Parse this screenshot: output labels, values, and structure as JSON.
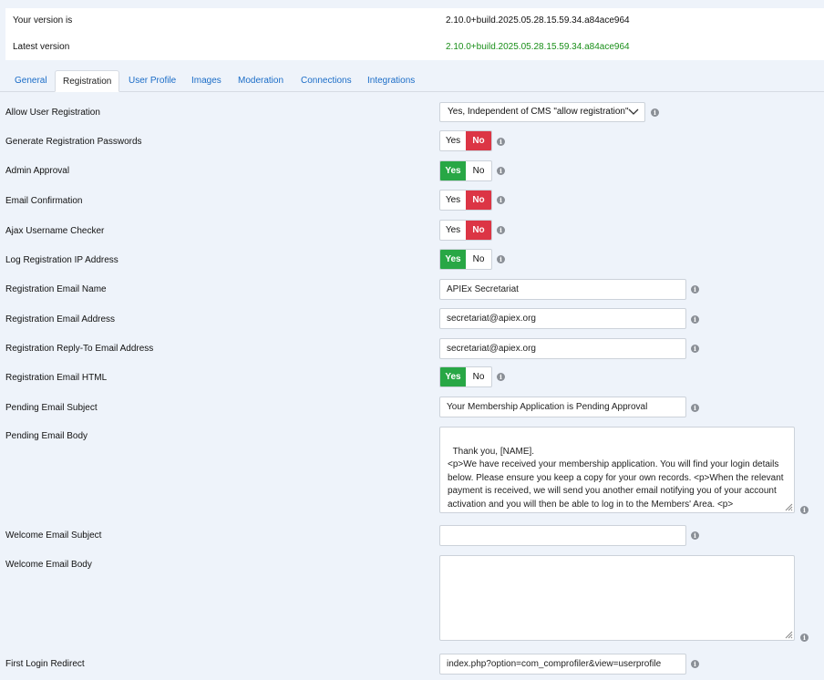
{
  "version": {
    "current_label": "Your version is",
    "current_value": "2.10.0+build.2025.05.28.15.59.34.a84ace964",
    "latest_label": "Latest version",
    "latest_value": "2.10.0+build.2025.05.28.15.59.34.a84ace964",
    "latest_color": "#1a8f1a"
  },
  "tabs": [
    "General",
    "Registration",
    "User Profile",
    "Images",
    "Moderation",
    "Connections",
    "Integrations"
  ],
  "active_tab": "Registration",
  "toggle_labels": {
    "yes": "Yes",
    "no": "No"
  },
  "colors": {
    "yes_active": "#28a745",
    "no_active": "#dc3545",
    "link": "#1a6cc7"
  },
  "fields": {
    "allow_registration": {
      "label": "Allow User Registration",
      "value": "Yes, Independent of CMS \"allow registration\""
    },
    "generate_passwords": {
      "label": "Generate Registration Passwords",
      "value": "No"
    },
    "admin_approval": {
      "label": "Admin Approval",
      "value": "Yes"
    },
    "email_confirmation": {
      "label": "Email Confirmation",
      "value": "No"
    },
    "ajax_checker": {
      "label": "Ajax Username Checker",
      "value": "No"
    },
    "log_ip": {
      "label": "Log Registration IP Address",
      "value": "Yes"
    },
    "email_name": {
      "label": "Registration Email Name",
      "value": "APIEx Secretariat"
    },
    "email_address": {
      "label": "Registration Email Address",
      "value": "secretariat@apiex.org"
    },
    "reply_to": {
      "label": "Registration Reply-To Email Address",
      "value": "secretariat@apiex.org"
    },
    "email_html": {
      "label": "Registration Email HTML",
      "value": "Yes"
    },
    "pending_subject": {
      "label": "Pending Email Subject",
      "value": "Your Membership Application is Pending Approval"
    },
    "pending_body": {
      "label": "Pending Email Body",
      "value": "Thank you, [NAME].\n<p>We have received your membership application. You will find your login details below. Please ensure you keep a copy for your own records. <p>When the relevant payment is received, we will send you another email notifying you of your account activation and you will then be able to log in to the Members' Area. <p>\n\n<APPLICATION DETAILS>"
    },
    "welcome_subject": {
      "label": "Welcome Email Subject",
      "value": ""
    },
    "welcome_body": {
      "label": "Welcome Email Body",
      "value": ""
    },
    "first_login_redirect": {
      "label": "First Login Redirect",
      "value": "index.php?option=com_comprofiler&view=userprofile"
    }
  },
  "icons": {
    "info": "info-circle-icon",
    "dropdown": "chevron-down-icon",
    "resize": "resize-grip-icon"
  }
}
